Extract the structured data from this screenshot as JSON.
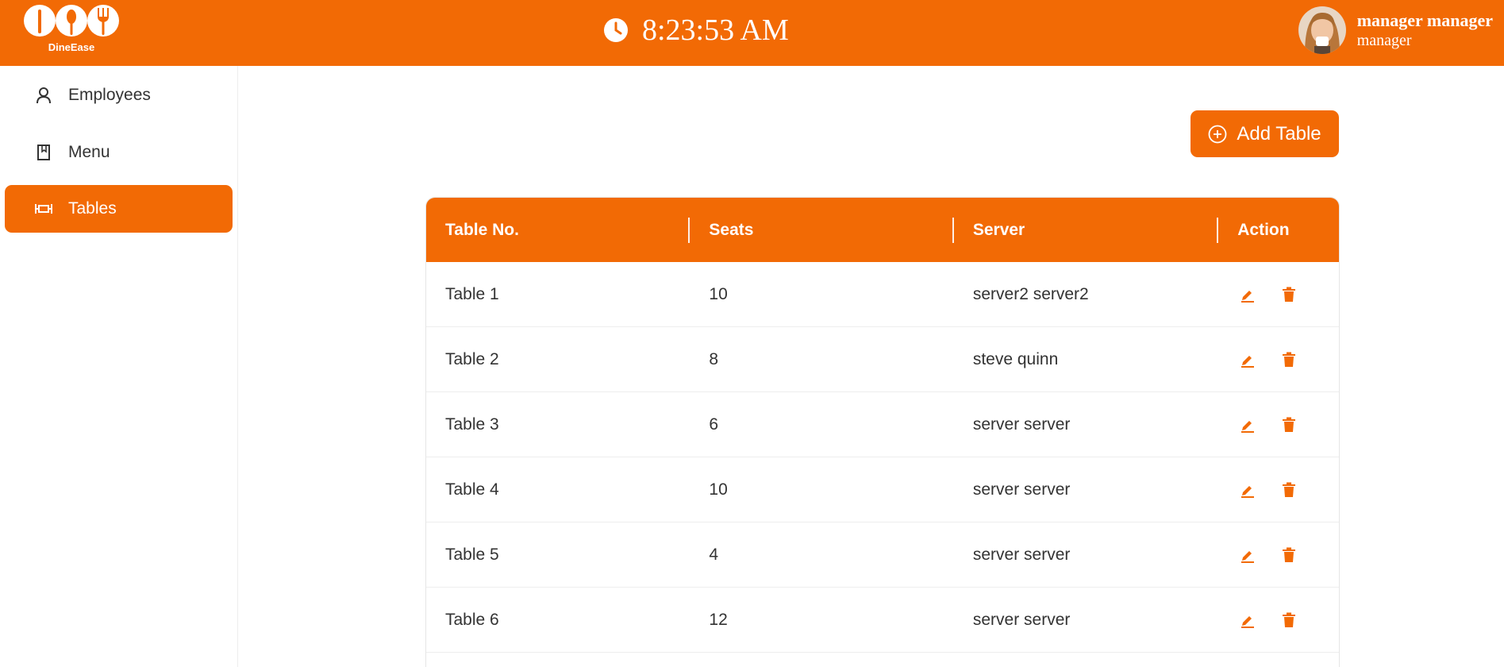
{
  "app": {
    "logo_text": "DineEase"
  },
  "header": {
    "time": "8:23:53 AM",
    "user_name": "manager manager",
    "user_role": "manager"
  },
  "sidebar": {
    "items": [
      {
        "label": "Employees",
        "icon": "user-icon",
        "active": false
      },
      {
        "label": "Menu",
        "icon": "book-icon",
        "active": false
      },
      {
        "label": "Tables",
        "icon": "table-icon",
        "active": true
      }
    ]
  },
  "main": {
    "add_button_label": "Add Table",
    "table": {
      "columns": [
        "Table No.",
        "Seats",
        "Server",
        "Action"
      ],
      "rows": [
        {
          "table_no": "Table 1",
          "seats": "10",
          "server": "server2 server2"
        },
        {
          "table_no": "Table 2",
          "seats": "8",
          "server": "steve quinn"
        },
        {
          "table_no": "Table 3",
          "seats": "6",
          "server": "server server"
        },
        {
          "table_no": "Table 4",
          "seats": "10",
          "server": "server server"
        },
        {
          "table_no": "Table 5",
          "seats": "4",
          "server": "server server"
        },
        {
          "table_no": "Table 6",
          "seats": "12",
          "server": "server server"
        }
      ]
    }
  },
  "colors": {
    "accent": "#f26a05",
    "text": "#333333",
    "background": "#ffffff"
  }
}
